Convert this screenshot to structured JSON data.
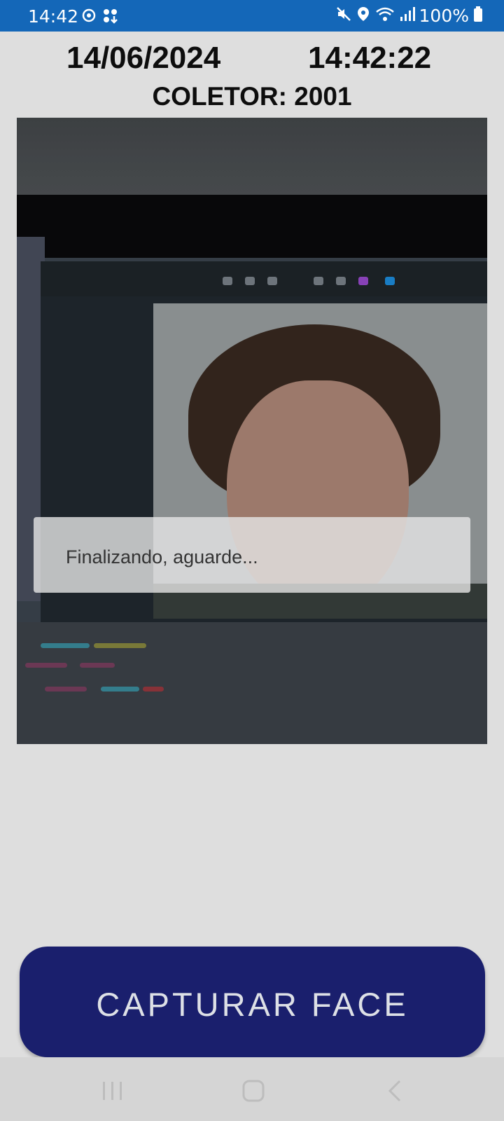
{
  "status_bar": {
    "time": "14:42",
    "battery": "100%",
    "left_icons": [
      "sync-icon",
      "apps-download-icon"
    ],
    "right_icons": [
      "mute-icon",
      "location-icon",
      "wifi-icon",
      "signal-icon",
      "battery-icon"
    ],
    "background": "#1467b8"
  },
  "header": {
    "date": "14/06/2024",
    "time": "14:42:22",
    "collector": "COLETOR: 2001"
  },
  "camera": {
    "toast": "Finalizando, aguarde..."
  },
  "actions": {
    "capture_label": "CAPTURAR FACE",
    "accent": "#1a1f6d"
  },
  "nav": {
    "buttons": [
      "recents-icon",
      "home-icon",
      "back-icon"
    ]
  }
}
